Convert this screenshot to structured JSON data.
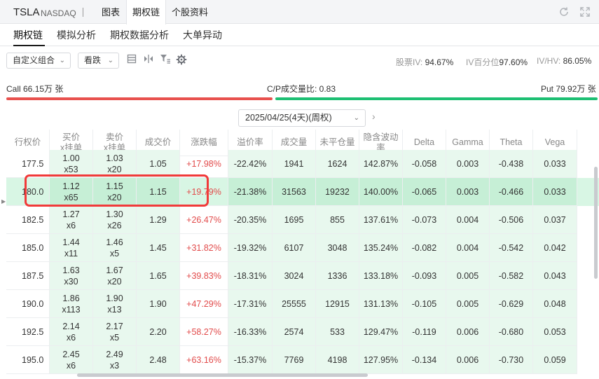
{
  "header": {
    "ticker": "TSLA",
    "exchange": "NASDAQ",
    "tabs": [
      {
        "label": "图表",
        "active": false
      },
      {
        "label": "期权链",
        "active": true
      },
      {
        "label": "个股资料",
        "active": false
      }
    ],
    "refresh_icon": "refresh-icon",
    "expand_icon": "expand-icon"
  },
  "subtabs": [
    {
      "label": "期权链",
      "active": true
    },
    {
      "label": "模拟分析",
      "active": false
    },
    {
      "label": "期权数据分析",
      "active": false
    },
    {
      "label": "大单异动",
      "active": false
    }
  ],
  "toolbar": {
    "combo_select": "自定义组合",
    "direction_select": "看跌",
    "icons": [
      "list-icon",
      "split-icon",
      "filter-icon",
      "gear-icon"
    ]
  },
  "stats": {
    "stock_iv_label": "股票IV:",
    "stock_iv": "94.67%",
    "iv_pct_label": "IV百分位",
    "iv_pct": "97.60%",
    "iv_hv_label": "IV/HV:",
    "iv_hv": "86.05%"
  },
  "volume_bar": {
    "call_label": "Call 66.15万 张",
    "ratio_label": "C/P成交量比: 0.83",
    "put_label": "Put 79.92万 张",
    "call_color": "#e8514e",
    "put_color": "#1dbf73"
  },
  "expiry": {
    "selected": "2025/04/25(4天)(周权)"
  },
  "table": {
    "headers": [
      {
        "line1": "行权价",
        "line2": ""
      },
      {
        "line1": "买价",
        "line2": "x挂单"
      },
      {
        "line1": "卖价",
        "line2": "x挂单"
      },
      {
        "line1": "成交价",
        "line2": ""
      },
      {
        "line1": "涨跌幅",
        "line2": ""
      },
      {
        "line1": "溢价率",
        "line2": ""
      },
      {
        "line1": "成交量",
        "line2": ""
      },
      {
        "line1": "未平仓量",
        "line2": ""
      },
      {
        "line1": "隐含波动率",
        "line2": ""
      },
      {
        "line1": "Delta",
        "line2": ""
      },
      {
        "line1": "Gamma",
        "line2": ""
      },
      {
        "line1": "Theta",
        "line2": ""
      },
      {
        "line1": "Vega",
        "line2": ""
      }
    ],
    "rows": [
      {
        "strike": "177.5",
        "bid": "1.00",
        "bid_size": "x53",
        "ask": "1.03",
        "ask_size": "x20",
        "last": "1.05",
        "change": "+17.98%",
        "premium": "-22.42%",
        "volume": "1941",
        "oi": "1624",
        "iv": "142.87%",
        "delta": "-0.058",
        "gamma": "0.003",
        "theta": "-0.438",
        "vega": "0.033"
      },
      {
        "strike": "180.0",
        "bid": "1.12",
        "bid_size": "x65",
        "ask": "1.15",
        "ask_size": "x20",
        "last": "1.15",
        "change": "+19.79%",
        "premium": "-21.38%",
        "volume": "31563",
        "oi": "19232",
        "iv": "140.00%",
        "delta": "-0.065",
        "gamma": "0.003",
        "theta": "-0.466",
        "vega": "0.033"
      },
      {
        "strike": "182.5",
        "bid": "1.27",
        "bid_size": "x6",
        "ask": "1.30",
        "ask_size": "x26",
        "last": "1.29",
        "change": "+26.47%",
        "premium": "-20.35%",
        "volume": "1695",
        "oi": "855",
        "iv": "137.61%",
        "delta": "-0.073",
        "gamma": "0.004",
        "theta": "-0.506",
        "vega": "0.037"
      },
      {
        "strike": "185.0",
        "bid": "1.44",
        "bid_size": "x11",
        "ask": "1.46",
        "ask_size": "x5",
        "last": "1.45",
        "change": "+31.82%",
        "premium": "-19.32%",
        "volume": "6107",
        "oi": "3048",
        "iv": "135.24%",
        "delta": "-0.082",
        "gamma": "0.004",
        "theta": "-0.542",
        "vega": "0.042"
      },
      {
        "strike": "187.5",
        "bid": "1.63",
        "bid_size": "x30",
        "ask": "1.67",
        "ask_size": "x20",
        "last": "1.65",
        "change": "+39.83%",
        "premium": "-18.31%",
        "volume": "3024",
        "oi": "1336",
        "iv": "133.18%",
        "delta": "-0.093",
        "gamma": "0.005",
        "theta": "-0.582",
        "vega": "0.043"
      },
      {
        "strike": "190.0",
        "bid": "1.86",
        "bid_size": "x113",
        "ask": "1.90",
        "ask_size": "x13",
        "last": "1.90",
        "change": "+47.29%",
        "premium": "-17.31%",
        "volume": "25555",
        "oi": "12915",
        "iv": "131.13%",
        "delta": "-0.105",
        "gamma": "0.005",
        "theta": "-0.629",
        "vega": "0.048"
      },
      {
        "strike": "192.5",
        "bid": "2.14",
        "bid_size": "x6",
        "ask": "2.17",
        "ask_size": "x5",
        "last": "2.20",
        "change": "+58.27%",
        "premium": "-16.33%",
        "volume": "2574",
        "oi": "533",
        "iv": "129.47%",
        "delta": "-0.119",
        "gamma": "0.006",
        "theta": "-0.680",
        "vega": "0.053"
      },
      {
        "strike": "195.0",
        "bid": "2.45",
        "bid_size": "x6",
        "ask": "2.49",
        "ask_size": "x3",
        "last": "2.48",
        "change": "+63.16%",
        "premium": "-15.37%",
        "volume": "7769",
        "oi": "4198",
        "iv": "127.95%",
        "delta": "-0.134",
        "gamma": "0.006",
        "theta": "-0.730",
        "vega": "0.059"
      }
    ],
    "highlighted_row": 1
  },
  "colors": {
    "accent_green": "#1dbf73",
    "accent_red": "#e24b4b",
    "highlight_row": "#d8f6e4",
    "annotation_box": "#f13a3a"
  }
}
